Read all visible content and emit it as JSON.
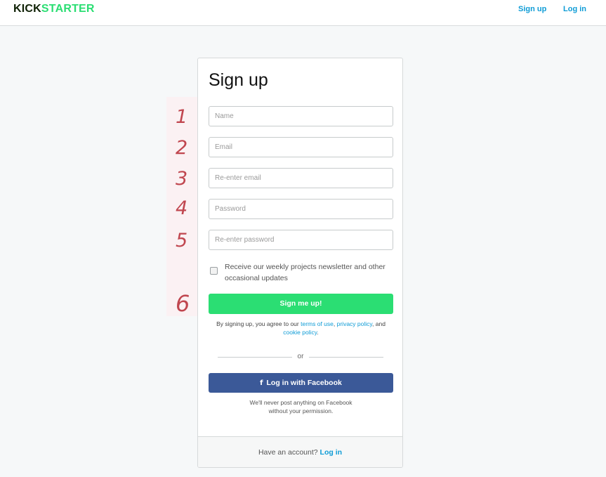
{
  "header": {
    "logo_kick": "KICK",
    "logo_starter": "STARTER",
    "signup_link": "Sign up",
    "login_link": "Log in"
  },
  "colors": {
    "brand_green": "#2bde73",
    "brand_dark": "#0f2105",
    "link_blue": "#0f9cd6",
    "facebook_blue": "#3b5998",
    "annotation_red": "#c0464f"
  },
  "annotations": [
    "1",
    "2",
    "3",
    "4",
    "5",
    "6"
  ],
  "form": {
    "title": "Sign up",
    "fields": [
      {
        "placeholder": "Name",
        "value": ""
      },
      {
        "placeholder": "Email",
        "value": ""
      },
      {
        "placeholder": "Re-enter email",
        "value": ""
      },
      {
        "placeholder": "Password",
        "value": ""
      },
      {
        "placeholder": "Re-enter password",
        "value": ""
      }
    ],
    "newsletter_label": "Receive our weekly projects newsletter and other occasional updates",
    "newsletter_checked": false,
    "submit_label": "Sign me up!",
    "terms_prefix": "By signing up, you agree to our ",
    "terms_link": "terms of use",
    "terms_sep": ", ",
    "privacy_link": "privacy policy",
    "terms_and": ", and ",
    "cookie_link": "cookie policy",
    "terms_end": ".",
    "divider_text": "or",
    "facebook_icon": "facebook-icon",
    "facebook_glyph": "f",
    "facebook_label": "Log in with Facebook",
    "facebook_note_1": "We'll never post anything on Facebook",
    "facebook_note_2": "without your permission."
  },
  "footer": {
    "prompt": "Have an account? ",
    "login_link": "Log in"
  }
}
